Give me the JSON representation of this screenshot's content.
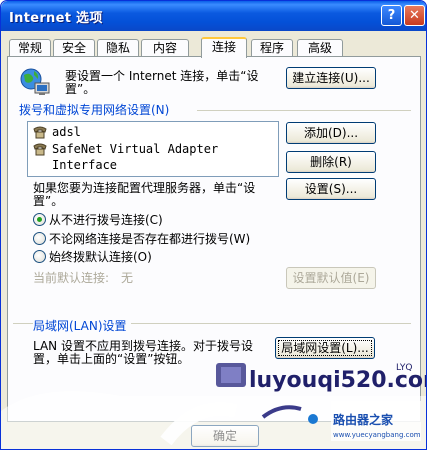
{
  "window": {
    "title": "Internet 选项",
    "help_button": "?",
    "close_button": "✕"
  },
  "tabs": [
    {
      "label": "常规",
      "active": false
    },
    {
      "label": "安全",
      "active": false
    },
    {
      "label": "隐私",
      "active": false
    },
    {
      "label": "内容",
      "active": false
    },
    {
      "label": "连接",
      "active": true
    },
    {
      "label": "程序",
      "active": false
    },
    {
      "label": "高级",
      "active": false
    }
  ],
  "setup": {
    "text_line1": "要设置一个 Internet 连接，单击“设",
    "text_line2": "置”。",
    "button": "建立连接(U)..."
  },
  "dialup": {
    "group_label": "拨号和虚拟专用网络设置(N)",
    "items": [
      "adsl",
      "SafeNet Virtual Adapter Interface"
    ],
    "add_button": "添加(D)...",
    "remove_button": "删除(R)",
    "settings_button": "设置(S)...",
    "proxy_text_line1": "如果您要为连接配置代理服务器，单击“设",
    "proxy_text_line2": "置”。",
    "options": [
      {
        "label": "从不进行拨号连接(C)",
        "selected": true
      },
      {
        "label": "不论网络连接是否存在都进行拨号(W)",
        "selected": false
      },
      {
        "label": "始终拨默认连接(O)",
        "selected": false
      }
    ],
    "current_default_label": "当前默认连接:",
    "current_default_value": "无",
    "set_default_button": "设置默认值(E)"
  },
  "lan": {
    "group_label": "局域网(LAN)设置",
    "text_line1": "LAN 设置不应用到拨号连接。对于拨号设",
    "text_line2": "置，单击上面的“设置”按钮。",
    "button": "局域网设置(L)..."
  },
  "footer": {
    "ok_button": "确定"
  },
  "watermark": {
    "site_text": "luyouqi520.com",
    "corner_text": "LYQ",
    "brand_text": "路由器之家",
    "brand_url": "www.yuecyangbang.com"
  }
}
